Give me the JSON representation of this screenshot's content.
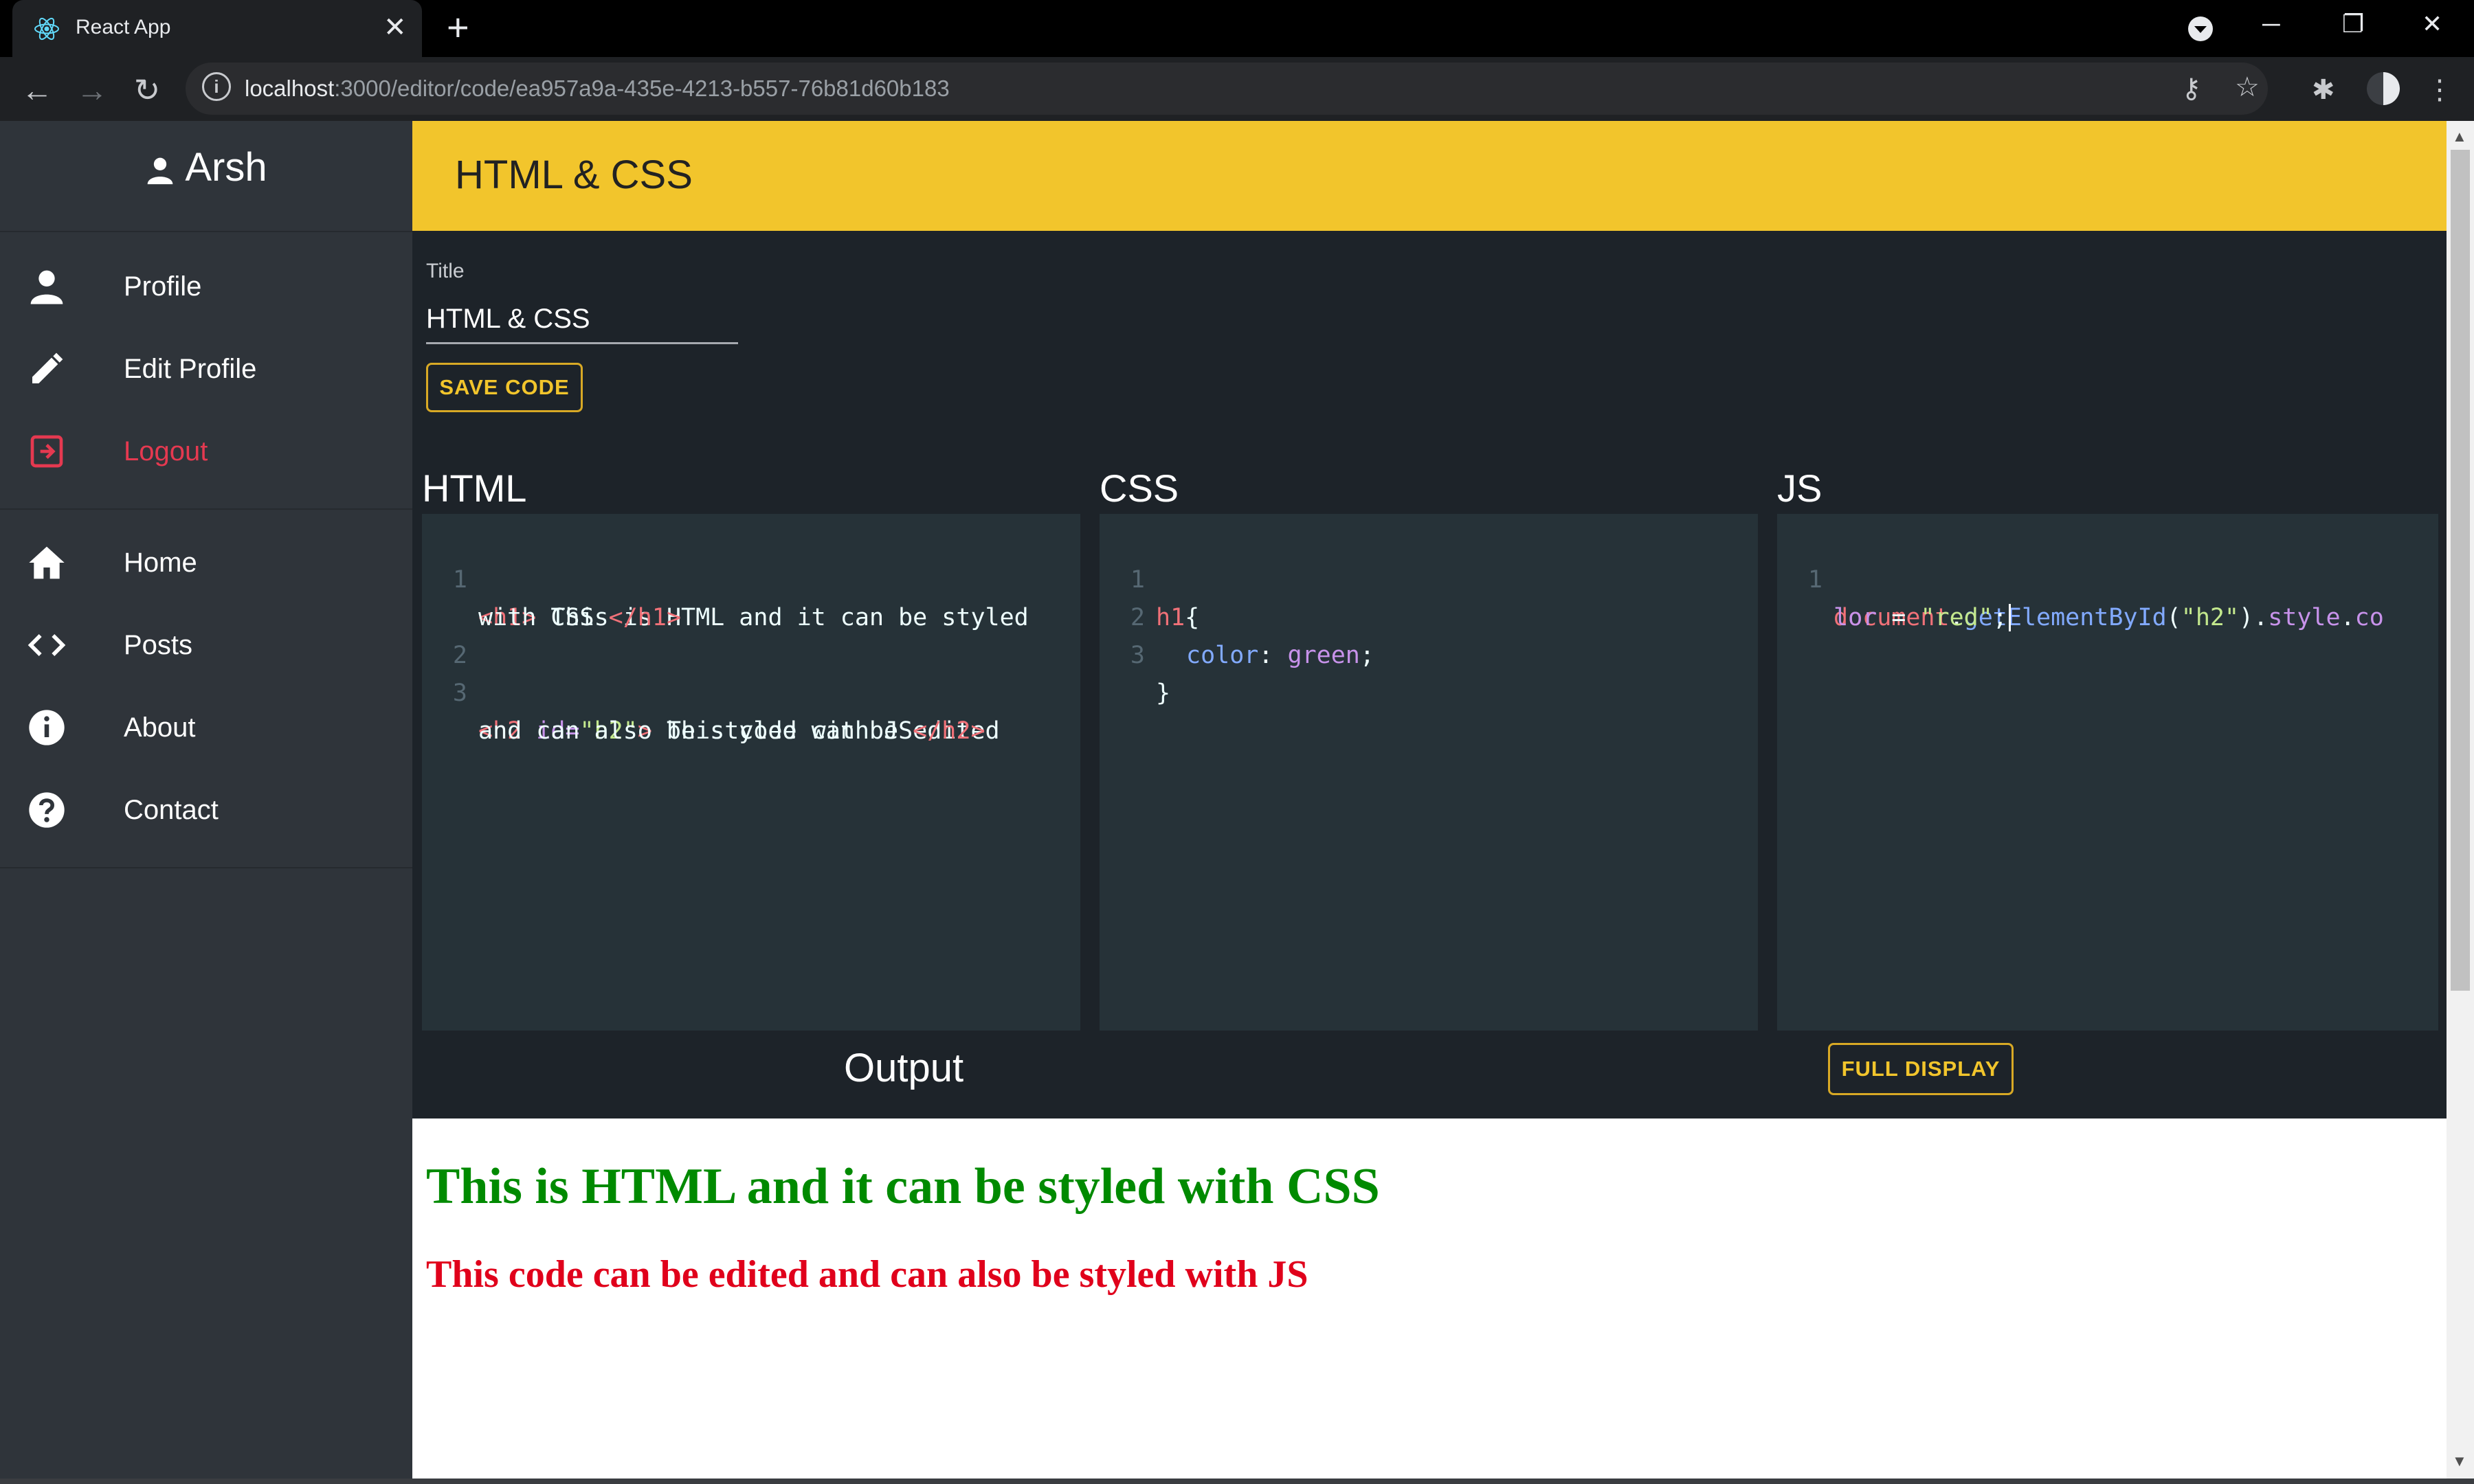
{
  "browser": {
    "tab_title": "React App",
    "url_host": "localhost",
    "url_rest": ":3000/editor/code/ea957a9a-435e-4213-b557-76b81d60b183",
    "favicon": "react-icon"
  },
  "sidebar": {
    "user_name": "Arsh",
    "items": [
      {
        "label": "Profile",
        "icon": "person-icon"
      },
      {
        "label": "Edit Profile",
        "icon": "pencil-icon"
      },
      {
        "label": "Logout",
        "icon": "logout-icon"
      },
      {
        "label": "Home",
        "icon": "home-icon"
      },
      {
        "label": "Posts",
        "icon": "code-icon"
      },
      {
        "label": "About",
        "icon": "info-icon"
      },
      {
        "label": "Contact",
        "icon": "help-icon"
      }
    ]
  },
  "header": {
    "title": "HTML & CSS"
  },
  "form": {
    "title_label": "Title",
    "title_value": "HTML & CSS",
    "save_label": "SAVE CODE"
  },
  "editors": {
    "html": {
      "title": "HTML",
      "line_numbers": [
        "1",
        "2",
        "3"
      ],
      "lines": {
        "l1a_open": "<h1>",
        "l1a_text": " This is HTML and it can be styled",
        "l1b_text": "with CSS ",
        "l1b_close": "</h1>",
        "l3a_open": "<h2",
        "l3a_attr": " id=",
        "l3a_val": "\"h2\"",
        "l3a_end": ">",
        "l3a_text": " This code can be edited",
        "l3b_text": "and can also be styled with JS",
        "l3b_close": "</h2>"
      }
    },
    "css": {
      "title": "CSS",
      "line_numbers": [
        "1",
        "2",
        "3"
      ],
      "lines": {
        "l1_sel": "h1",
        "l1_brace": "{",
        "l2_prop": "color",
        "l2_colon": ": ",
        "l2_val": "green",
        "l2_semi": ";",
        "l3_brace": "}"
      }
    },
    "js": {
      "title": "JS",
      "line_numbers": [
        "1"
      ],
      "lines": {
        "l1_obj": "document",
        "l1_dot1": ".",
        "l1_fn": "getElementById",
        "l1_paren1": "(",
        "l1_arg": "\"h2\"",
        "l1_paren2": ").",
        "l1_prop": "style",
        "l1_dot2": ".",
        "l1_prop2a": "co",
        "l2_prop2b": "lor",
        "l2_eq": " = ",
        "l2_val": "\"red\"",
        "l2_semi": ";"
      }
    }
  },
  "output": {
    "title": "Output",
    "full_label": "FULL DISPLAY",
    "h1": "This is HTML and it can be styled with CSS",
    "h2": "This code can be edited and can also be styled with JS"
  },
  "colors": {
    "header": "#f2c52c",
    "sidebar": "#2f343a",
    "editor_bg": "#263238",
    "logout": "#e53950",
    "output_h1": "#008a00",
    "output_h2": "#e0001b"
  }
}
